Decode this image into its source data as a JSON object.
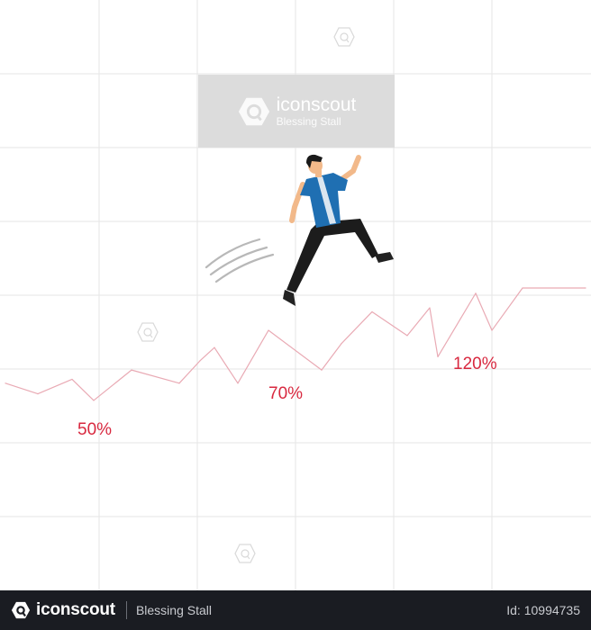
{
  "illustration": {
    "subject": "businessman jumping over a rising growth line chart",
    "colors": {
      "shirt": "#1f6fb2",
      "shirt_stripe": "#dbe6f0",
      "pants": "#1c1c1c",
      "skin": "#f2b98a",
      "hair": "#1a1a1a",
      "chart_line": "#e9aab4",
      "label": "#d8283f",
      "grid": "#e6e6e6",
      "motion_lines": "#b8b8b8"
    }
  },
  "chart_data": {
    "type": "line",
    "title": "",
    "xlabel": "",
    "ylabel": "",
    "grid": true,
    "series": [
      {
        "name": "growth",
        "values": [
          0.28,
          0.2,
          0.31,
          0.15,
          0.38,
          0.28,
          0.45,
          0.55,
          0.28,
          0.68,
          0.38,
          0.58,
          0.82,
          0.64,
          0.85,
          0.48,
          0.96,
          0.68,
          1.0,
          1.0
        ]
      }
    ],
    "annotations": [
      {
        "label": "50%",
        "at_index": 3
      },
      {
        "label": "70%",
        "at_index": 8
      },
      {
        "label": "120%",
        "at_index": 13
      }
    ]
  },
  "labels": {
    "pct_50": "50%",
    "pct_70": "70%",
    "pct_120": "120%"
  },
  "watermark": {
    "brand": "iconscout",
    "author": "Blessing Stall"
  },
  "footer": {
    "brand": "iconscout",
    "author": "Blessing Stall",
    "asset_id": "Id: 10994735"
  }
}
